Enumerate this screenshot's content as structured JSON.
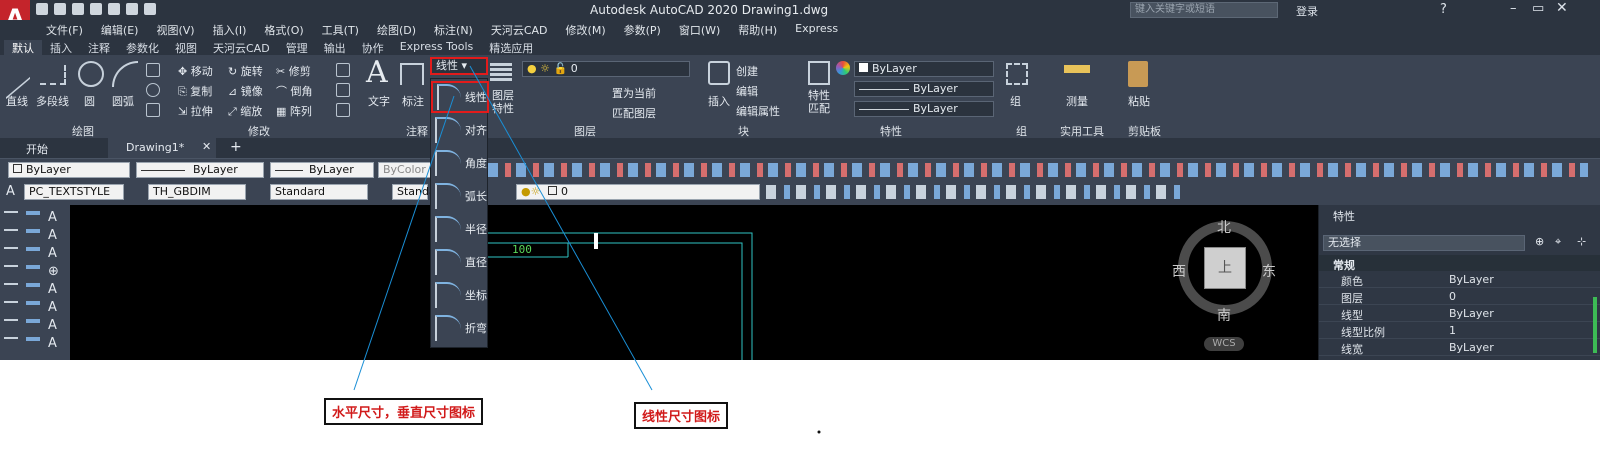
{
  "app": {
    "logo": "A",
    "title": "Autodesk AutoCAD 2020    Drawing1.dwg",
    "search_placeholder": "键入关键字或短语",
    "login": "登录"
  },
  "menu": [
    "文件(F)",
    "编辑(E)",
    "视图(V)",
    "插入(I)",
    "格式(O)",
    "工具(T)",
    "绘图(D)",
    "标注(N)",
    "天河云CAD",
    "修改(M)",
    "参数(P)",
    "窗口(W)",
    "帮助(H)",
    "Express"
  ],
  "ribbon_tabs": [
    "默认",
    "插入",
    "注释",
    "参数化",
    "视图",
    "天河云CAD",
    "管理",
    "输出",
    "协作",
    "Express Tools",
    "精选应用"
  ],
  "ribbon": {
    "draw": {
      "line": "直线",
      "polyline": "多段线",
      "circle": "圆",
      "arc": "圆弧",
      "panel": "绘图"
    },
    "modify": {
      "move": "移动",
      "rotate": "旋转",
      "trim": "修剪",
      "copy": "复制",
      "mirror": "镜像",
      "fillet": "倒角",
      "stretch": "拉伸",
      "scale": "缩放",
      "array": "阵列",
      "panel": "修改"
    },
    "annotation": {
      "text": "文字",
      "dim": "标注",
      "panel": "注释",
      "linear": "线性"
    },
    "layers": {
      "props": "图层\n特性",
      "layer_value": "0",
      "set_current": "置为当前",
      "match": "匹配图层",
      "panel": "图层"
    },
    "block": {
      "insert": "插入",
      "create": "创建",
      "edit": "编辑",
      "edit_attr": "编辑属性",
      "panel": "块"
    },
    "properties": {
      "match": "特性\n匹配",
      "bylayer": "ByLayer",
      "panel": "特性"
    },
    "group": {
      "label": "组",
      "panel": "组"
    },
    "utilities": {
      "measure": "测量",
      "panel": "实用工具"
    },
    "clipboard": {
      "paste": "粘贴",
      "panel": "剪贴板"
    }
  },
  "file_tabs": [
    "开始",
    "Drawing1*"
  ],
  "toolbar1": {
    "color": "ByLayer",
    "linetype": "ByLayer",
    "lineweight": "ByLayer",
    "plotstyle": "ByColor"
  },
  "toolbar2": {
    "textstyle": "PC_TEXTSTYLE",
    "dimstyle": "TH_GBDIM",
    "tablestyle": "Standard",
    "mleader": "Standard",
    "layer": "0"
  },
  "flyout": [
    {
      "label": "线性",
      "icon": "linear-dim-icon"
    },
    {
      "label": "对齐",
      "icon": "aligned-dim-icon"
    },
    {
      "label": "角度",
      "icon": "angular-dim-icon"
    },
    {
      "label": "弧长",
      "icon": "arc-length-icon"
    },
    {
      "label": "半径",
      "icon": "radius-dim-icon"
    },
    {
      "label": "直径",
      "icon": "diameter-dim-icon"
    },
    {
      "label": "坐标",
      "icon": "ordinate-dim-icon"
    },
    {
      "label": "折弯",
      "icon": "jogged-dim-icon"
    }
  ],
  "drawing": {
    "dim_text": "100"
  },
  "viewcube": {
    "n": "北",
    "s": "南",
    "e": "东",
    "w": "西",
    "face": "上",
    "wcs": "WCS"
  },
  "properties": {
    "header": "特性",
    "selection": "无选择",
    "section": "常规",
    "rows": [
      {
        "k": "颜色",
        "v": "ByLayer"
      },
      {
        "k": "图层",
        "v": "0"
      },
      {
        "k": "线型",
        "v": "ByLayer"
      },
      {
        "k": "线型比例",
        "v": "1"
      },
      {
        "k": "线宽",
        "v": "ByLayer"
      }
    ]
  },
  "callouts": {
    "left": "水平尺寸，垂直尺寸图标",
    "right": "线性尺寸图标"
  }
}
